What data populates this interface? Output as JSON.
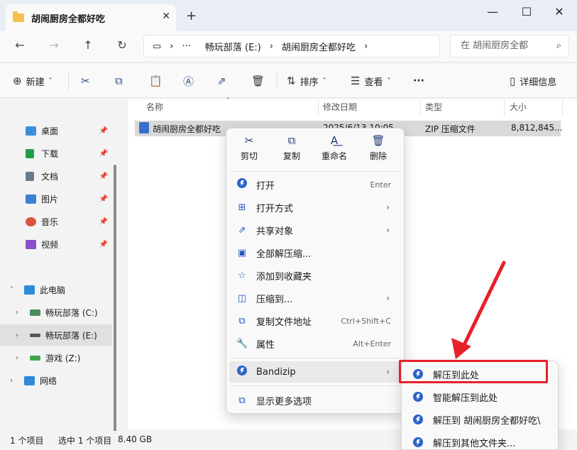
{
  "window": {
    "tab_title": "胡闹厨房全都好吃",
    "tab_close": "✕",
    "new_tab": "+",
    "minimize": "—",
    "maximize": "☐",
    "close": "✕"
  },
  "nav": {
    "back": "←",
    "forward": "→",
    "up": "↑",
    "refresh": "↻",
    "breadcrumb": {
      "pc_icon": "▭",
      "sep1": "›",
      "ellipsis": "···",
      "drive": "畅玩部落 (E:)",
      "sep2": "›",
      "folder": "胡闹厨房全都好吃",
      "sep3": "›"
    },
    "search_placeholder": "在 胡闹厨房全都",
    "search_icon": "⌕"
  },
  "toolbar": {
    "new_label": "新建",
    "new_chevron": "˅",
    "sort_label": "排序",
    "sort_chevron": "˅",
    "view_label": "查看",
    "view_chevron": "˅",
    "more": "···",
    "details_label": "详细信息"
  },
  "sidebar": {
    "quick": [
      {
        "label": "桌面",
        "color": "#3b8fd8"
      },
      {
        "label": "下载",
        "color": "#1f9e4a"
      },
      {
        "label": "文档",
        "color": "#6a7a8e"
      },
      {
        "label": "图片",
        "color": "#3c7fd6"
      },
      {
        "label": "音乐",
        "color": "#d9553f"
      },
      {
        "label": "视频",
        "color": "#8a4fc9"
      }
    ],
    "pin_glyph": "📌",
    "this_pc": "此电脑",
    "drives": [
      {
        "label": "畅玩部落 (C:)"
      },
      {
        "label": "畅玩部落 (E:)"
      },
      {
        "label": "游戏 (Z:)"
      }
    ],
    "network": "网络"
  },
  "columns": {
    "name": "名称",
    "date": "修改日期",
    "type": "类型",
    "size": "大小",
    "sort_arrow": "˄"
  },
  "file": {
    "name": "胡闹厨房全都好吃",
    "date": "2025/6/13 10:05",
    "type": "ZIP 压缩文件",
    "size": "8,812,845..."
  },
  "context_menu": {
    "top_actions": [
      {
        "label": "剪切",
        "icon": "✂"
      },
      {
        "label": "复制",
        "icon": "⧉"
      },
      {
        "label": "重命名",
        "icon": "A͟"
      },
      {
        "label": "删除",
        "icon": "🗑"
      }
    ],
    "items": [
      {
        "label": "打开",
        "shortcut": "Enter",
        "icon": "bandizip-icon"
      },
      {
        "label": "打开方式",
        "arrow": "›",
        "icon": "open-with-icon"
      },
      {
        "label": "共享对象",
        "arrow": "›",
        "icon": "share-icon"
      },
      {
        "label": "全部解压缩...",
        "icon": "extract-all-icon"
      },
      {
        "label": "添加到收藏夹",
        "icon": "star-icon"
      },
      {
        "label": "压缩到...",
        "arrow": "›",
        "icon": "compress-icon"
      },
      {
        "label": "复制文件地址",
        "shortcut": "Ctrl+Shift+C",
        "icon": "copy-path-icon"
      },
      {
        "label": "属性",
        "shortcut": "Alt+Enter",
        "icon": "wrench-icon"
      },
      {
        "label": "Bandizip",
        "arrow": "›",
        "icon": "bandizip-icon"
      },
      {
        "label": "显示更多选项",
        "icon": "more-options-icon"
      }
    ]
  },
  "submenu": {
    "items": [
      {
        "label": "解压到此处"
      },
      {
        "label": "智能解压到此处"
      },
      {
        "label": "解压到 胡闹厨房全都好吃\\"
      },
      {
        "label": "解压到其他文件夹..."
      }
    ]
  },
  "status": {
    "count": "1 个项目",
    "selected": "选中 1 个项目",
    "size": "8.40 GB"
  },
  "colors": {
    "highlight_red": "#e8202a",
    "accent_blue": "#2b62c9"
  }
}
